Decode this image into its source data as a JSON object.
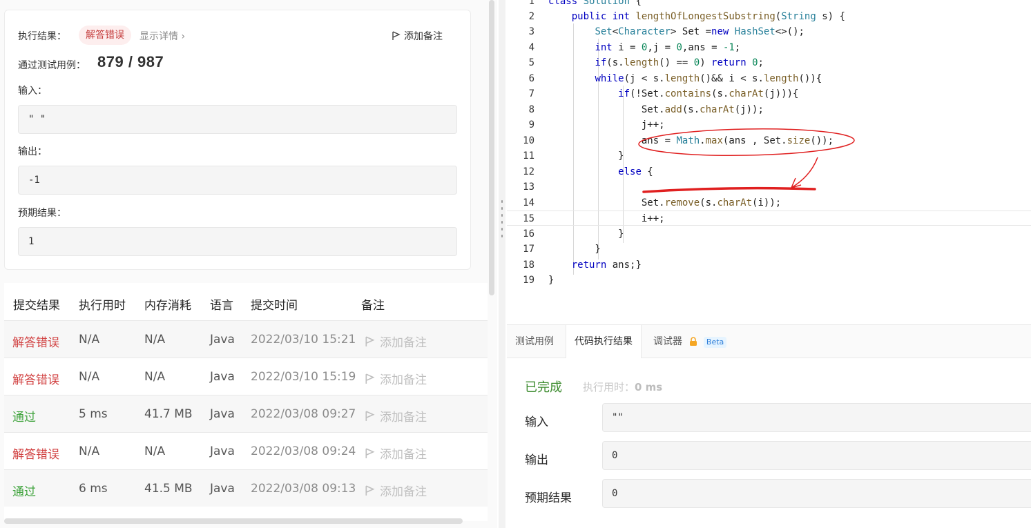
{
  "result": {
    "exec_label": "执行结果：",
    "exec_status": "解答错误",
    "show_detail": "显示详情 ›",
    "add_note": "添加备注",
    "pass_label": "通过测试用例：",
    "pass_value": "879 / 987",
    "input_label": "输入：",
    "input_value": "\" \"",
    "output_label": "输出：",
    "output_value": "-1",
    "expected_label": "预期结果：",
    "expected_value": "1"
  },
  "submissions": {
    "headers": [
      "提交结果",
      "执行用时",
      "内存消耗",
      "语言",
      "提交时间",
      "备注"
    ],
    "rows": [
      {
        "status": "解答错误",
        "time": "N/A",
        "memory": "N/A",
        "lang": "Java",
        "submitted": "2022/03/10 15:21",
        "note": "添加备注"
      },
      {
        "status": "解答错误",
        "time": "N/A",
        "memory": "N/A",
        "lang": "Java",
        "submitted": "2022/03/10 15:19",
        "note": "添加备注"
      },
      {
        "status": "通过",
        "time": "5 ms",
        "memory": "41.7 MB",
        "lang": "Java",
        "submitted": "2022/03/08 09:27",
        "note": "添加备注"
      },
      {
        "status": "解答错误",
        "time": "N/A",
        "memory": "N/A",
        "lang": "Java",
        "submitted": "2022/03/08 09:24",
        "note": "添加备注"
      },
      {
        "status": "通过",
        "time": "6 ms",
        "memory": "41.5 MB",
        "lang": "Java",
        "submitted": "2022/03/08 09:13",
        "note": "添加备注"
      }
    ]
  },
  "editor": {
    "line_numbers": [
      "1",
      "2",
      "3",
      "4",
      "5",
      "6",
      "7",
      "8",
      "9",
      "10",
      "11",
      "12",
      "13",
      "14",
      "15",
      "16",
      "17",
      "18",
      "19"
    ]
  },
  "bottom": {
    "tabs": [
      "测试用例",
      "代码执行结果",
      "调试器"
    ],
    "beta": "Beta",
    "done": "已完成",
    "runtime_label": "执行用时：",
    "runtime_value": "0 ms",
    "input_label": "输入",
    "input_value": "\"\"",
    "output_label": "输出",
    "output_value": "0",
    "expected_label": "预期结果",
    "expected_value": "0"
  },
  "colors": {
    "error": "#d14040",
    "success": "#3fa33c",
    "annotation": "#e02020"
  }
}
